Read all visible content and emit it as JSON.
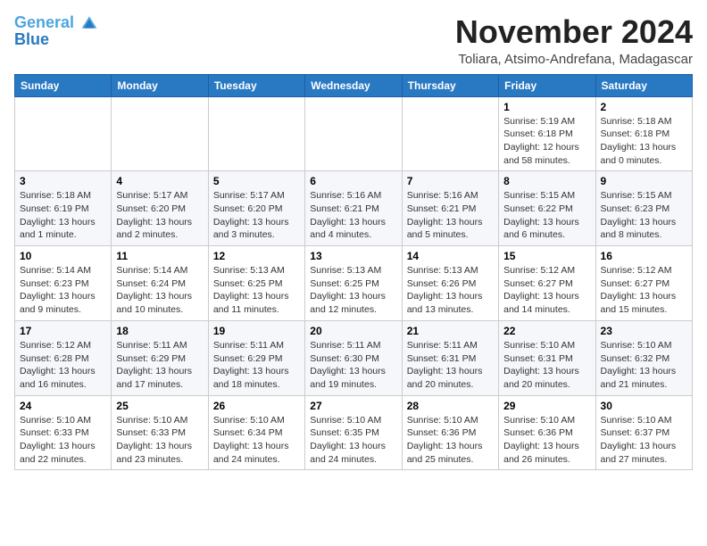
{
  "logo": {
    "line1": "General",
    "line2": "Blue"
  },
  "header": {
    "month": "November 2024",
    "location": "Toliara, Atsimo-Andrefana, Madagascar"
  },
  "weekdays": [
    "Sunday",
    "Monday",
    "Tuesday",
    "Wednesday",
    "Thursday",
    "Friday",
    "Saturday"
  ],
  "weeks": [
    [
      {
        "day": "",
        "info": ""
      },
      {
        "day": "",
        "info": ""
      },
      {
        "day": "",
        "info": ""
      },
      {
        "day": "",
        "info": ""
      },
      {
        "day": "",
        "info": ""
      },
      {
        "day": "1",
        "info": "Sunrise: 5:19 AM\nSunset: 6:18 PM\nDaylight: 12 hours\nand 58 minutes."
      },
      {
        "day": "2",
        "info": "Sunrise: 5:18 AM\nSunset: 6:18 PM\nDaylight: 13 hours\nand 0 minutes."
      }
    ],
    [
      {
        "day": "3",
        "info": "Sunrise: 5:18 AM\nSunset: 6:19 PM\nDaylight: 13 hours\nand 1 minute."
      },
      {
        "day": "4",
        "info": "Sunrise: 5:17 AM\nSunset: 6:20 PM\nDaylight: 13 hours\nand 2 minutes."
      },
      {
        "day": "5",
        "info": "Sunrise: 5:17 AM\nSunset: 6:20 PM\nDaylight: 13 hours\nand 3 minutes."
      },
      {
        "day": "6",
        "info": "Sunrise: 5:16 AM\nSunset: 6:21 PM\nDaylight: 13 hours\nand 4 minutes."
      },
      {
        "day": "7",
        "info": "Sunrise: 5:16 AM\nSunset: 6:21 PM\nDaylight: 13 hours\nand 5 minutes."
      },
      {
        "day": "8",
        "info": "Sunrise: 5:15 AM\nSunset: 6:22 PM\nDaylight: 13 hours\nand 6 minutes."
      },
      {
        "day": "9",
        "info": "Sunrise: 5:15 AM\nSunset: 6:23 PM\nDaylight: 13 hours\nand 8 minutes."
      }
    ],
    [
      {
        "day": "10",
        "info": "Sunrise: 5:14 AM\nSunset: 6:23 PM\nDaylight: 13 hours\nand 9 minutes."
      },
      {
        "day": "11",
        "info": "Sunrise: 5:14 AM\nSunset: 6:24 PM\nDaylight: 13 hours\nand 10 minutes."
      },
      {
        "day": "12",
        "info": "Sunrise: 5:13 AM\nSunset: 6:25 PM\nDaylight: 13 hours\nand 11 minutes."
      },
      {
        "day": "13",
        "info": "Sunrise: 5:13 AM\nSunset: 6:25 PM\nDaylight: 13 hours\nand 12 minutes."
      },
      {
        "day": "14",
        "info": "Sunrise: 5:13 AM\nSunset: 6:26 PM\nDaylight: 13 hours\nand 13 minutes."
      },
      {
        "day": "15",
        "info": "Sunrise: 5:12 AM\nSunset: 6:27 PM\nDaylight: 13 hours\nand 14 minutes."
      },
      {
        "day": "16",
        "info": "Sunrise: 5:12 AM\nSunset: 6:27 PM\nDaylight: 13 hours\nand 15 minutes."
      }
    ],
    [
      {
        "day": "17",
        "info": "Sunrise: 5:12 AM\nSunset: 6:28 PM\nDaylight: 13 hours\nand 16 minutes."
      },
      {
        "day": "18",
        "info": "Sunrise: 5:11 AM\nSunset: 6:29 PM\nDaylight: 13 hours\nand 17 minutes."
      },
      {
        "day": "19",
        "info": "Sunrise: 5:11 AM\nSunset: 6:29 PM\nDaylight: 13 hours\nand 18 minutes."
      },
      {
        "day": "20",
        "info": "Sunrise: 5:11 AM\nSunset: 6:30 PM\nDaylight: 13 hours\nand 19 minutes."
      },
      {
        "day": "21",
        "info": "Sunrise: 5:11 AM\nSunset: 6:31 PM\nDaylight: 13 hours\nand 20 minutes."
      },
      {
        "day": "22",
        "info": "Sunrise: 5:10 AM\nSunset: 6:31 PM\nDaylight: 13 hours\nand 20 minutes."
      },
      {
        "day": "23",
        "info": "Sunrise: 5:10 AM\nSunset: 6:32 PM\nDaylight: 13 hours\nand 21 minutes."
      }
    ],
    [
      {
        "day": "24",
        "info": "Sunrise: 5:10 AM\nSunset: 6:33 PM\nDaylight: 13 hours\nand 22 minutes."
      },
      {
        "day": "25",
        "info": "Sunrise: 5:10 AM\nSunset: 6:33 PM\nDaylight: 13 hours\nand 23 minutes."
      },
      {
        "day": "26",
        "info": "Sunrise: 5:10 AM\nSunset: 6:34 PM\nDaylight: 13 hours\nand 24 minutes."
      },
      {
        "day": "27",
        "info": "Sunrise: 5:10 AM\nSunset: 6:35 PM\nDaylight: 13 hours\nand 24 minutes."
      },
      {
        "day": "28",
        "info": "Sunrise: 5:10 AM\nSunset: 6:36 PM\nDaylight: 13 hours\nand 25 minutes."
      },
      {
        "day": "29",
        "info": "Sunrise: 5:10 AM\nSunset: 6:36 PM\nDaylight: 13 hours\nand 26 minutes."
      },
      {
        "day": "30",
        "info": "Sunrise: 5:10 AM\nSunset: 6:37 PM\nDaylight: 13 hours\nand 27 minutes."
      }
    ]
  ]
}
